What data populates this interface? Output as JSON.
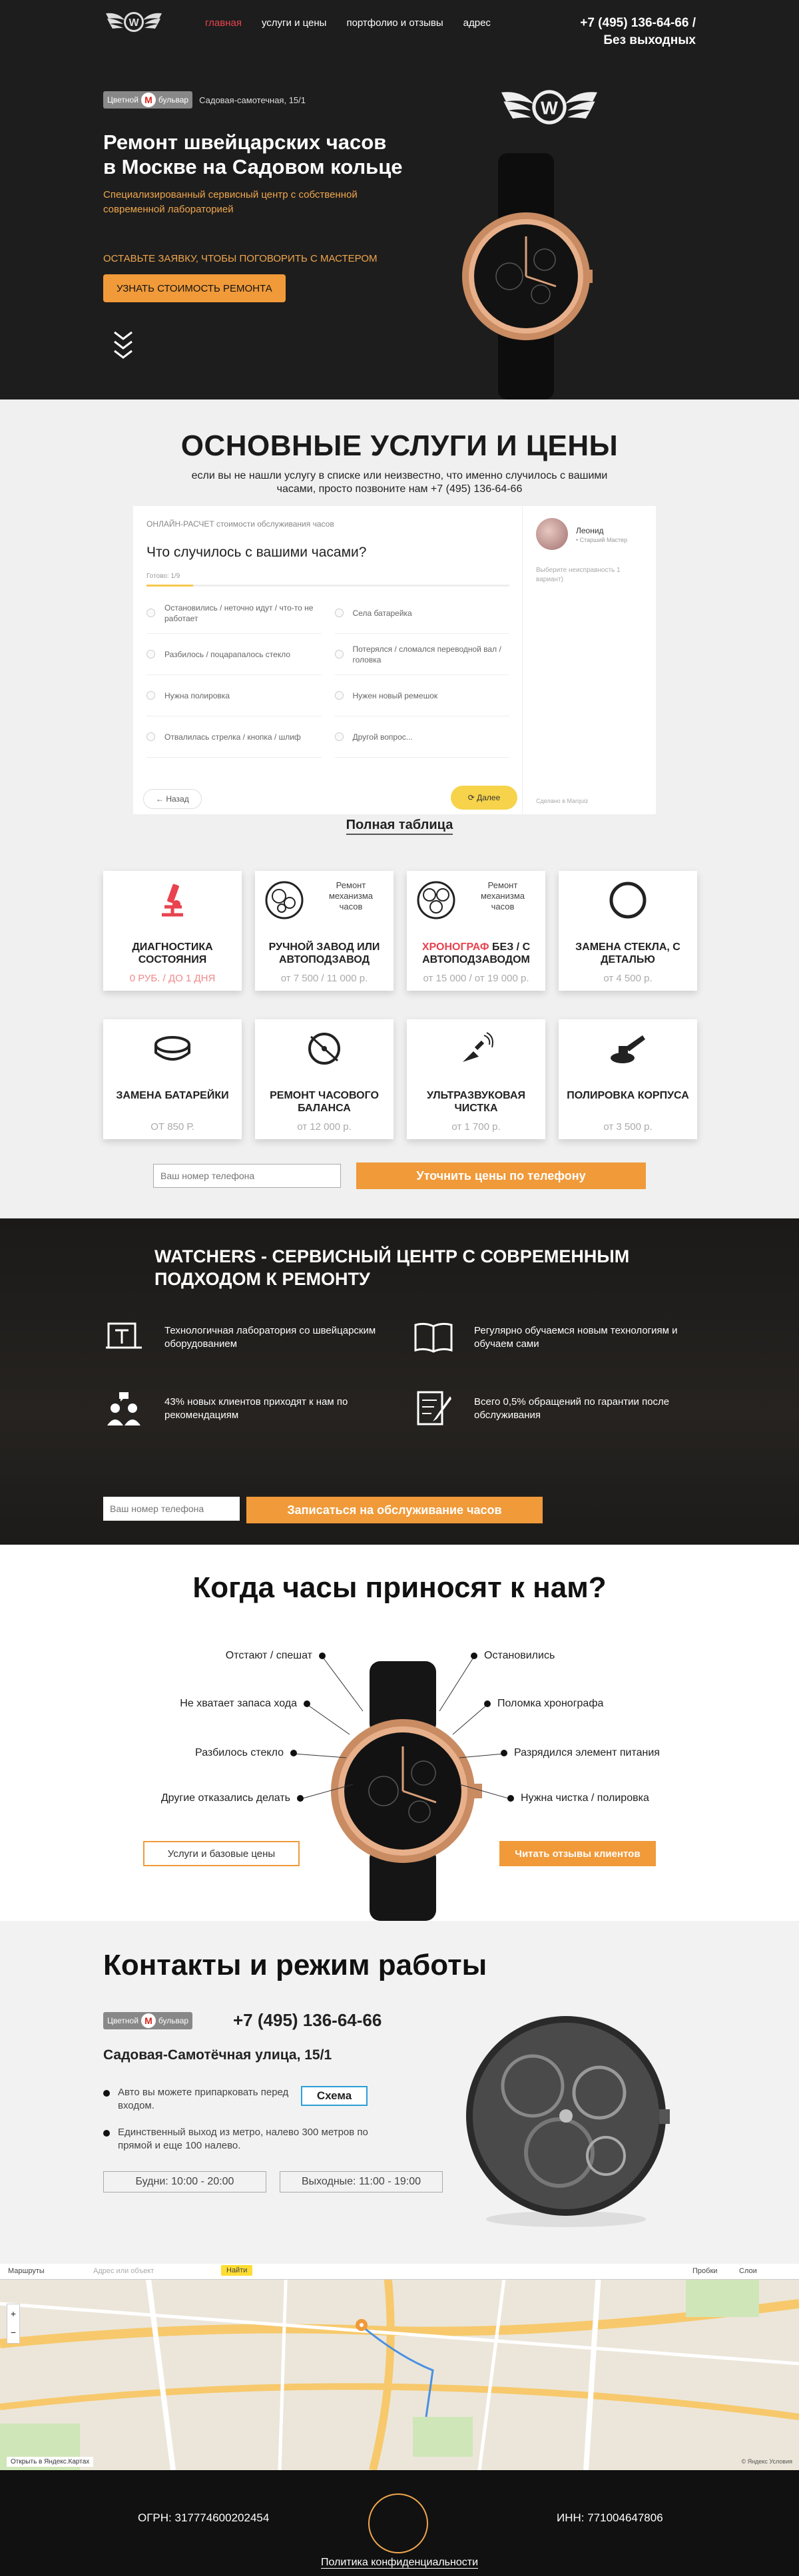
{
  "nav": {
    "items": [
      "главная",
      "услуги и цены",
      "портфолио и отзывы",
      "адрес"
    ],
    "phone": "+7 (495) 136-64-66 /",
    "phone_note": "Без выходных"
  },
  "metro": {
    "prefix": "Цветной",
    "m": "М",
    "suffix": "бульвар",
    "address": "Садовая-самотечная, 15/1"
  },
  "hero": {
    "title_line1": "Ремонт швейцарских часов",
    "title_line2": "в Москве на Садовом кольце",
    "sub": "Специализированный сервисный центр с собственной современной лабораторией",
    "cta_text": "ОСТАВЬТЕ ЗАЯВКУ, ЧТОБЫ ПОГОВОРИТЬ С МАСТЕРОМ",
    "cta_button": "УЗНАТЬ СТОИМОСТЬ РЕМОНТА",
    "logo_letter": "W"
  },
  "services": {
    "title": "ОСНОВНЫЕ УСЛУГИ И ЦЕНЫ",
    "subtitle": "если вы не нашли услугу в списке или неизвестно, что именно случилось с вашими часами, просто позвоните нам +7 (495) 136-64-66",
    "calc": {
      "header": "ОНЛАЙН-РАСЧЕТ стоимости обслуживания часов",
      "question": "Что случилось с вашими часами?",
      "steps": "Готово: 1/9",
      "options": [
        "Остановились / неточно идут / что-то не работает",
        "Села батарейка",
        "Разбилось / поцарапалось стекло",
        "Потерялся / сломался переводной вал / головка",
        "Нужна полировка",
        "Нужен новый ремешок",
        "Отвалилась стрелка / кнопка / шлиф",
        "Другой вопрос..."
      ],
      "back": "← Назад",
      "next": "⟳ Далее",
      "consultant_name": "Леонид",
      "consultant_role": "• Старший Мастер",
      "consultant_msg": "Выберите неисправность 1 вариант)",
      "footer": "Сделано в Marquiz"
    },
    "full_table": "Полная таблица",
    "cards": [
      {
        "title_red": "ДИАГНОСТИКА СОСТОЯНИЯ",
        "title": "",
        "price": "0 РУБ. / ДО 1 ДНЯ",
        "note": "",
        "icon": "microscope-icon"
      },
      {
        "title_red": "",
        "title": "РУЧНОЙ ЗАВОД ИЛИ АВТОПОДЗАВОД",
        "price": "от 7 500 / 11 000 р.",
        "note": "Ремонт механизма часов",
        "icon": "gear-mechanism-icon"
      },
      {
        "title_red": "ХРОНОГРАФ",
        "title": " БЕЗ / С АВТОПОДЗАВОДОМ",
        "price": "от 15 000 / от 19 000 р.",
        "note": "Ремонт механизма часов",
        "icon": "chronograph-mechanism-icon"
      },
      {
        "title_red": "",
        "title": "ЗАМЕНА СТЕКЛА, С ДЕТАЛЬЮ",
        "price": "от 4 500 р.",
        "note": "",
        "icon": "glass-icon"
      },
      {
        "title_red": "",
        "title": "ЗАМЕНА БАТАРЕЙКИ",
        "price": "ОТ 850 Р.",
        "note": "",
        "icon": "battery-icon"
      },
      {
        "title_red": "",
        "title": "РЕМОНТ ЧАСОВОГО БАЛАНСА",
        "price": "от 12 000 р.",
        "note": "",
        "icon": "balance-wheel-icon"
      },
      {
        "title_red": "",
        "title": "УЛЬТРАЗВУКОВАЯ ЧИСТКА",
        "price": "от 1 700 р.",
        "note": "",
        "icon": "ultrasonic-icon"
      },
      {
        "title_red": "",
        "title": "ПОЛИРОВКА КОРПУСА",
        "price": "от 3 500 р.",
        "note": "",
        "icon": "polisher-icon"
      }
    ],
    "phone_placeholder": "Ваш номер телефона",
    "phone_button": "Уточнить цены по телефону"
  },
  "watchers": {
    "title": "WATCHERS - СЕРВИСНЫЙ ЦЕНТР С СОВРЕМЕННЫМ ПОДХОДОМ К РЕМОНТУ",
    "features": [
      "Технологичная лаборатория со швейцарским оборудованием",
      "Регулярно обучаемся новым технологиям и обучаем сами",
      "43% новых клиентов приходят к нам по рекомендациям",
      "Всего 0,5% обращений по гарантии после обслуживания"
    ],
    "phone_placeholder": "Ваш номер телефона",
    "button": "Записаться на обслуживание часов"
  },
  "when": {
    "title": "Когда часы приносят к нам?",
    "left": [
      "Отстают / спешат",
      "Не хватает запаса хода",
      "Разбилось стекло",
      "Другие отказались делать"
    ],
    "right": [
      "Остановились",
      "Поломка хронографа",
      "Разрядился элемент питания",
      "Нужна чистка / полировка"
    ],
    "btn_services": "Услуги и базовые цены",
    "btn_reviews": "Читать отзывы клиентов"
  },
  "contacts": {
    "title": "Контакты и режим работы",
    "phone": "+7 (495) 136-64-66",
    "address": "Садовая-Самотёчная улица, 15/1",
    "car": "Авто вы можете припарковать перед входом.",
    "walk": "Единственный выход из метро, налево 300 метров по прямой и еще 100 налево.",
    "schema": "Схема",
    "weekdays": "Будни: 10:00 - 20:00",
    "weekend": "Выходные: 11:00 - 19:00"
  },
  "map": {
    "routes": "Маршруты",
    "search_ph": "Адрес или объект",
    "find": "Найти",
    "traffic": "Пробки",
    "layers": "Слои",
    "open": "Открыть в Яндекс.Картах",
    "copyright": "© Яндекс Условия"
  },
  "footer": {
    "ogrn": "ОГРН: 317774600202454",
    "inn": "ИНН: 771004647806",
    "policy": "Политика конфиденциальности"
  }
}
